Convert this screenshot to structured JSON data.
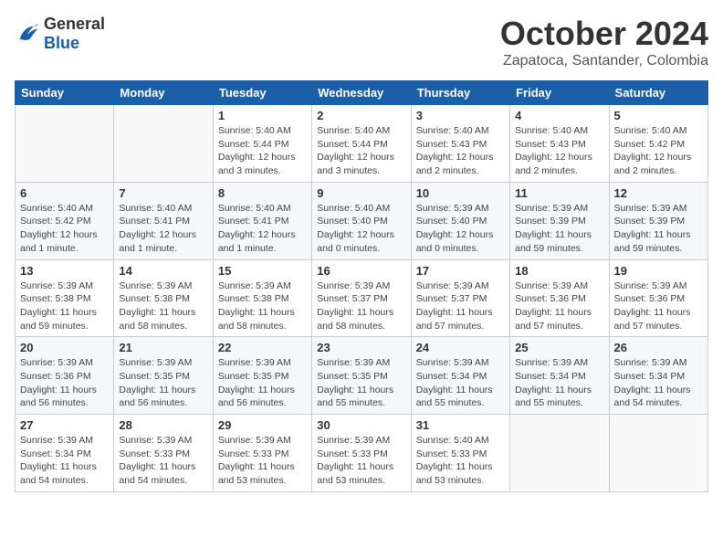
{
  "header": {
    "logo_general": "General",
    "logo_blue": "Blue",
    "title": "October 2024",
    "location": "Zapatoca, Santander, Colombia"
  },
  "calendar": {
    "days_of_week": [
      "Sunday",
      "Monday",
      "Tuesday",
      "Wednesday",
      "Thursday",
      "Friday",
      "Saturday"
    ],
    "weeks": [
      [
        {
          "day": "",
          "info": ""
        },
        {
          "day": "",
          "info": ""
        },
        {
          "day": "1",
          "info": "Sunrise: 5:40 AM\nSunset: 5:44 PM\nDaylight: 12 hours and 3 minutes."
        },
        {
          "day": "2",
          "info": "Sunrise: 5:40 AM\nSunset: 5:44 PM\nDaylight: 12 hours and 3 minutes."
        },
        {
          "day": "3",
          "info": "Sunrise: 5:40 AM\nSunset: 5:43 PM\nDaylight: 12 hours and 2 minutes."
        },
        {
          "day": "4",
          "info": "Sunrise: 5:40 AM\nSunset: 5:43 PM\nDaylight: 12 hours and 2 minutes."
        },
        {
          "day": "5",
          "info": "Sunrise: 5:40 AM\nSunset: 5:42 PM\nDaylight: 12 hours and 2 minutes."
        }
      ],
      [
        {
          "day": "6",
          "info": "Sunrise: 5:40 AM\nSunset: 5:42 PM\nDaylight: 12 hours and 1 minute."
        },
        {
          "day": "7",
          "info": "Sunrise: 5:40 AM\nSunset: 5:41 PM\nDaylight: 12 hours and 1 minute."
        },
        {
          "day": "8",
          "info": "Sunrise: 5:40 AM\nSunset: 5:41 PM\nDaylight: 12 hours and 1 minute."
        },
        {
          "day": "9",
          "info": "Sunrise: 5:40 AM\nSunset: 5:40 PM\nDaylight: 12 hours and 0 minutes."
        },
        {
          "day": "10",
          "info": "Sunrise: 5:39 AM\nSunset: 5:40 PM\nDaylight: 12 hours and 0 minutes."
        },
        {
          "day": "11",
          "info": "Sunrise: 5:39 AM\nSunset: 5:39 PM\nDaylight: 11 hours and 59 minutes."
        },
        {
          "day": "12",
          "info": "Sunrise: 5:39 AM\nSunset: 5:39 PM\nDaylight: 11 hours and 59 minutes."
        }
      ],
      [
        {
          "day": "13",
          "info": "Sunrise: 5:39 AM\nSunset: 5:38 PM\nDaylight: 11 hours and 59 minutes."
        },
        {
          "day": "14",
          "info": "Sunrise: 5:39 AM\nSunset: 5:38 PM\nDaylight: 11 hours and 58 minutes."
        },
        {
          "day": "15",
          "info": "Sunrise: 5:39 AM\nSunset: 5:38 PM\nDaylight: 11 hours and 58 minutes."
        },
        {
          "day": "16",
          "info": "Sunrise: 5:39 AM\nSunset: 5:37 PM\nDaylight: 11 hours and 58 minutes."
        },
        {
          "day": "17",
          "info": "Sunrise: 5:39 AM\nSunset: 5:37 PM\nDaylight: 11 hours and 57 minutes."
        },
        {
          "day": "18",
          "info": "Sunrise: 5:39 AM\nSunset: 5:36 PM\nDaylight: 11 hours and 57 minutes."
        },
        {
          "day": "19",
          "info": "Sunrise: 5:39 AM\nSunset: 5:36 PM\nDaylight: 11 hours and 57 minutes."
        }
      ],
      [
        {
          "day": "20",
          "info": "Sunrise: 5:39 AM\nSunset: 5:36 PM\nDaylight: 11 hours and 56 minutes."
        },
        {
          "day": "21",
          "info": "Sunrise: 5:39 AM\nSunset: 5:35 PM\nDaylight: 11 hours and 56 minutes."
        },
        {
          "day": "22",
          "info": "Sunrise: 5:39 AM\nSunset: 5:35 PM\nDaylight: 11 hours and 56 minutes."
        },
        {
          "day": "23",
          "info": "Sunrise: 5:39 AM\nSunset: 5:35 PM\nDaylight: 11 hours and 55 minutes."
        },
        {
          "day": "24",
          "info": "Sunrise: 5:39 AM\nSunset: 5:34 PM\nDaylight: 11 hours and 55 minutes."
        },
        {
          "day": "25",
          "info": "Sunrise: 5:39 AM\nSunset: 5:34 PM\nDaylight: 11 hours and 55 minutes."
        },
        {
          "day": "26",
          "info": "Sunrise: 5:39 AM\nSunset: 5:34 PM\nDaylight: 11 hours and 54 minutes."
        }
      ],
      [
        {
          "day": "27",
          "info": "Sunrise: 5:39 AM\nSunset: 5:34 PM\nDaylight: 11 hours and 54 minutes."
        },
        {
          "day": "28",
          "info": "Sunrise: 5:39 AM\nSunset: 5:33 PM\nDaylight: 11 hours and 54 minutes."
        },
        {
          "day": "29",
          "info": "Sunrise: 5:39 AM\nSunset: 5:33 PM\nDaylight: 11 hours and 53 minutes."
        },
        {
          "day": "30",
          "info": "Sunrise: 5:39 AM\nSunset: 5:33 PM\nDaylight: 11 hours and 53 minutes."
        },
        {
          "day": "31",
          "info": "Sunrise: 5:40 AM\nSunset: 5:33 PM\nDaylight: 11 hours and 53 minutes."
        },
        {
          "day": "",
          "info": ""
        },
        {
          "day": "",
          "info": ""
        }
      ]
    ]
  }
}
